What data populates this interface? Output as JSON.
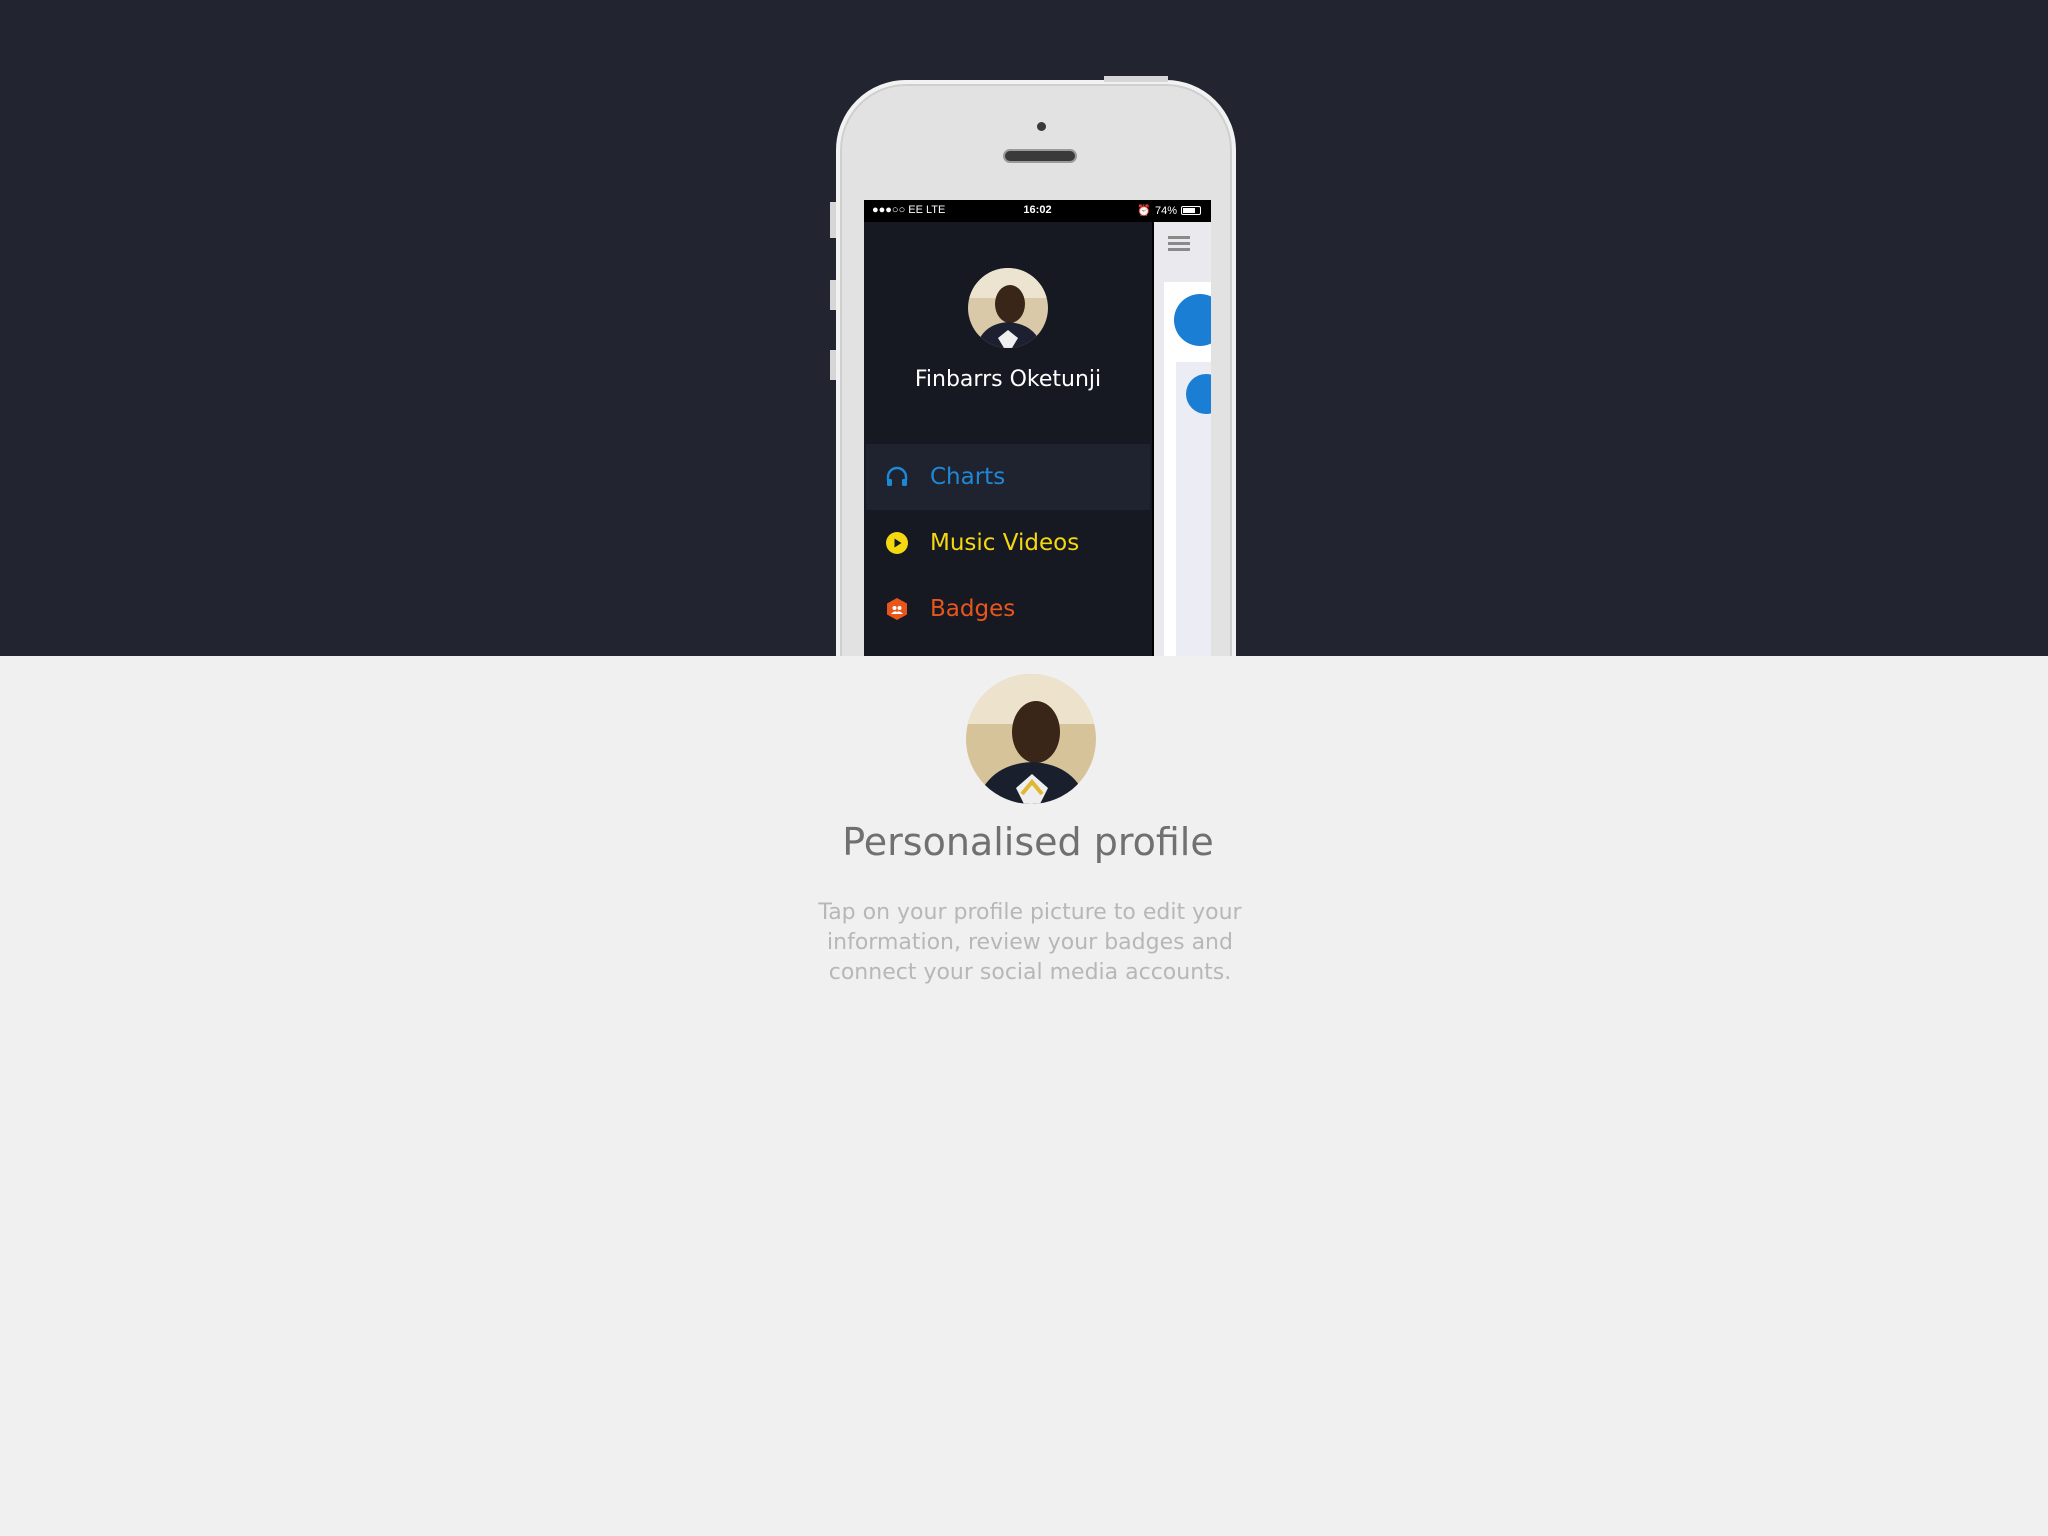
{
  "status_bar": {
    "carrier": "●●●○○ EE  LTE",
    "time": "16:02",
    "battery": "74%",
    "battery_level": 0.74
  },
  "menu": {
    "user_name": "Finbarrs Oketunji",
    "items": [
      {
        "label": "Charts",
        "icon": "headphones-icon",
        "color": "#1e88d6",
        "active": true
      },
      {
        "label": "Music Videos",
        "icon": "play-icon",
        "color": "#f5d80f",
        "active": false
      },
      {
        "label": "Badges",
        "icon": "hexagon-group-icon",
        "color": "#e8561c",
        "active": false
      }
    ]
  },
  "feature": {
    "title": "Personalised profile",
    "description": "Tap on your profile picture to edit your information, review your badges and connect your social media accounts."
  },
  "colors": {
    "background_dark": "#22252f",
    "background_light": "#f0f0f0",
    "menu_bg": "#161922",
    "accent_blue": "#1a7fd4"
  }
}
